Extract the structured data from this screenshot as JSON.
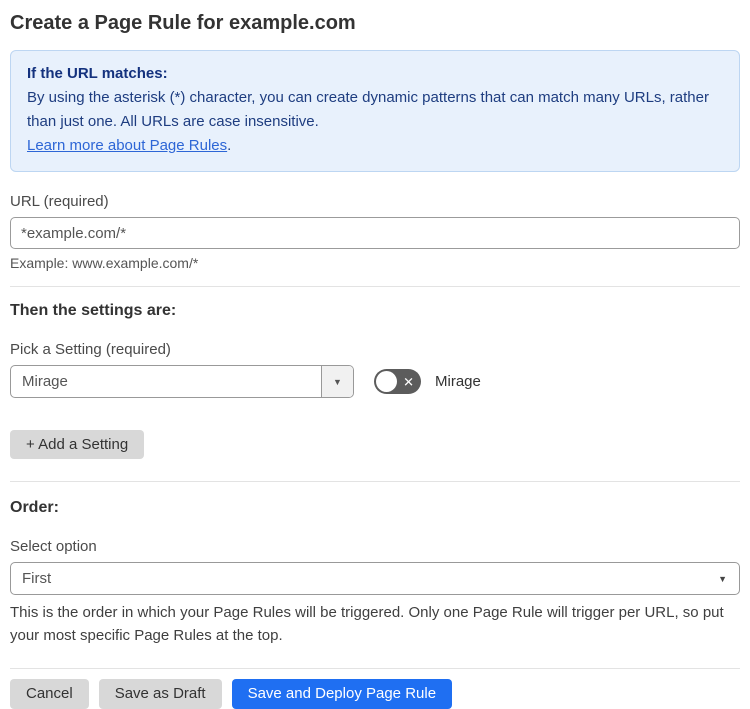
{
  "page": {
    "title": "Create a Page Rule for example.com"
  },
  "info_box": {
    "heading": "If the URL matches:",
    "body": "By using the asterisk (*) character, you can create dynamic patterns that can match many URLs, rather than just one. All URLs are case insensitive.",
    "link_label": "Learn more about Page Rules",
    "link_suffix": "."
  },
  "url_field": {
    "label": "URL (required)",
    "value": "*example.com/*",
    "example": "Example: www.example.com/*"
  },
  "settings_section": {
    "heading": "Then the settings are:",
    "pick_label": "Pick a Setting (required)",
    "selected_setting": "Mirage",
    "dropdown_icon": "▼",
    "toggle": {
      "state": "off",
      "x_glyph": "✕",
      "label": "Mirage"
    },
    "add_button_label": "+ Add a Setting"
  },
  "order_section": {
    "heading": "Order:",
    "label": "Select option",
    "selected_option": "First",
    "dropdown_icon": "▼",
    "help": "This is the order in which your Page Rules will be triggered. Only one Page Rule will trigger per URL, so put your most specific Page Rules at the top."
  },
  "footer": {
    "cancel_label": "Cancel",
    "save_draft_label": "Save as Draft",
    "save_deploy_label": "Save and Deploy Page Rule"
  },
  "colors": {
    "info_bg": "#e8f1fc",
    "info_border": "#bdd6f2",
    "info_text": "#1e3d80",
    "link_blue": "#2d66d6",
    "toggle_off_bg": "#5c5c5c",
    "primary_button_blue": "#1f6ff2",
    "secondary_button_gray": "#d8d8d8"
  }
}
